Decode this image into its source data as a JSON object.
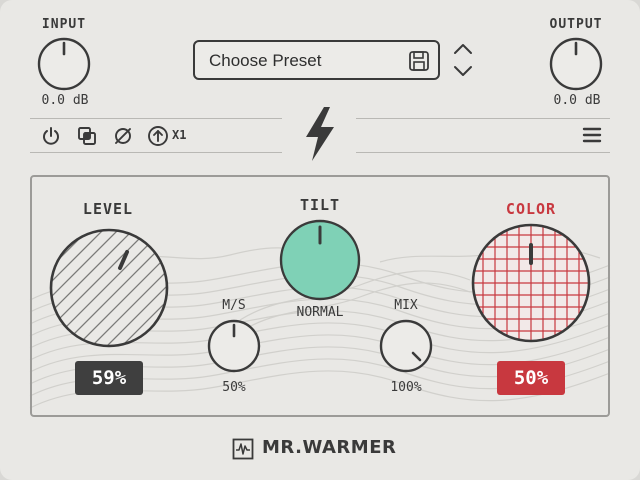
{
  "io": {
    "input_label": "INPUT",
    "input_value": "0.0 dB",
    "output_label": "OUTPUT",
    "output_value": "0.0 dB"
  },
  "preset": {
    "label": "Choose Preset"
  },
  "toolbar": {
    "icons": [
      "power-icon",
      "overlap-icon",
      "bypass-icon",
      "upsample-icon",
      "bolt-icon",
      "menu-icon"
    ],
    "oversample_label": "X1"
  },
  "controls": {
    "level": {
      "label": "LEVEL",
      "value": "59%"
    },
    "tilt": {
      "label": "TILT",
      "value": "NORMAL"
    },
    "ms": {
      "label": "M/S",
      "value": "50%"
    },
    "mix": {
      "label": "MIX",
      "value": "100%"
    },
    "color": {
      "label": "COLOR",
      "value": "50%"
    }
  },
  "brand": {
    "name": "MR.WARMER"
  },
  "colors": {
    "background": "#e9e8e5",
    "ink": "#3a3a3a",
    "accent_red": "#c8383f",
    "tilt_green": "#7fd1b6",
    "level_badge": "#3f3f3f"
  }
}
